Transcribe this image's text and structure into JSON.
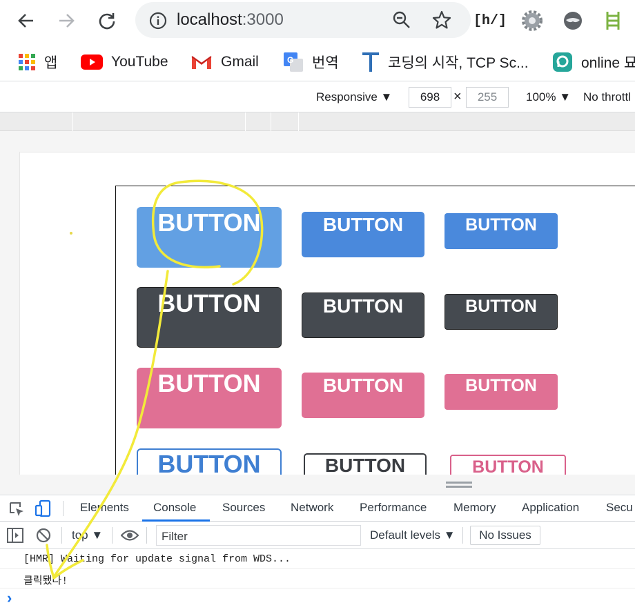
{
  "browser": {
    "url_host": "localhost",
    "url_port": ":3000",
    "bookmarks": [
      {
        "label": "앱"
      },
      {
        "label": "YouTube"
      },
      {
        "label": "Gmail"
      },
      {
        "label": "번역"
      },
      {
        "label": "코딩의 시작, TCP Sc..."
      },
      {
        "label": "online 묘"
      }
    ],
    "extension_h_label": "[h/]"
  },
  "device_toolbar": {
    "mode": "Responsive ▼",
    "width": "698",
    "x_sep": "×",
    "height": "255",
    "zoom": "100% ▼",
    "throttle": "No throttl"
  },
  "page": {
    "button_label": "BUTTON",
    "colors": {
      "blue": "#4a89dc",
      "blue_light": "#62a0e3",
      "dark": "#454a50",
      "pink": "#e07094",
      "outline_blue": "#3f7fd2",
      "outline_dark": "#3a3d42",
      "outline_pink": "#d9608a"
    }
  },
  "devtools": {
    "tabs": [
      "Elements",
      "Console",
      "Sources",
      "Network",
      "Performance",
      "Memory",
      "Application",
      "Secu"
    ],
    "active_tab": "Console",
    "context": "top ▼",
    "filter_placeholder": "Filter",
    "levels": "Default levels ▼",
    "issues": "No Issues",
    "console_lines": [
      "[HMR] Waiting for update signal from WDS...",
      "클릭됐다!"
    ],
    "prompt": "›"
  }
}
